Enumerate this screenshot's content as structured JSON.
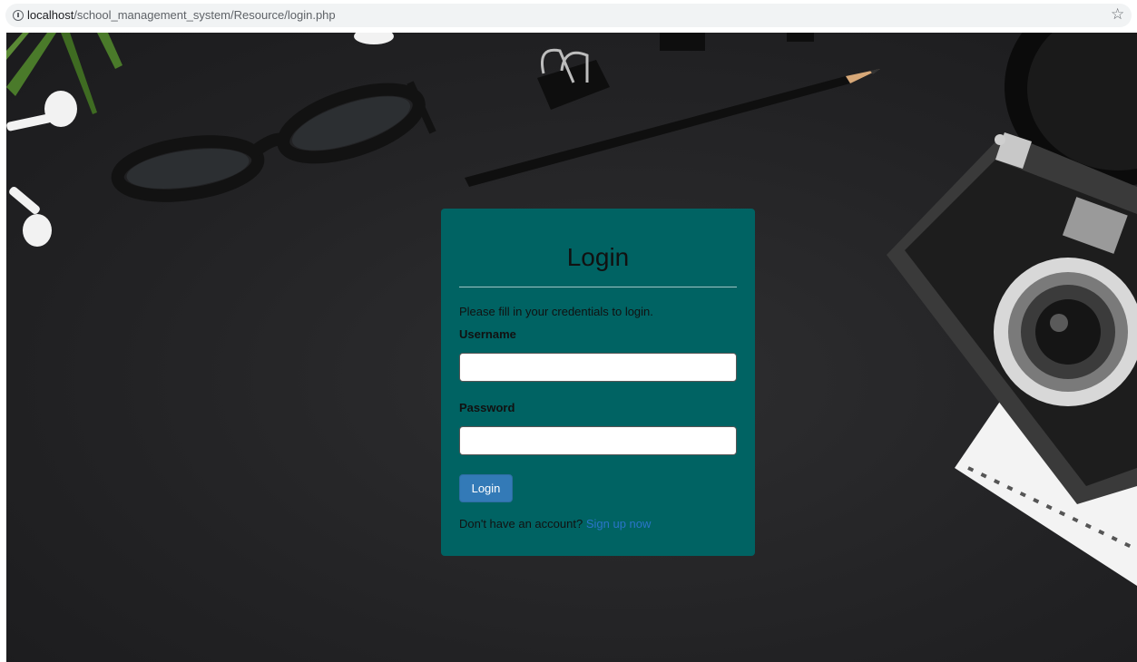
{
  "browser": {
    "url_host": "localhost",
    "url_path": "/school_management_system/Resource/login.php"
  },
  "login": {
    "title": "Login",
    "intro": "Please fill in your credentials to login.",
    "username_label": "Username",
    "username_value": "",
    "password_label": "Password",
    "password_value": "",
    "submit_label": "Login",
    "signup_prompt": "Don't have an account?",
    "signup_link": "Sign up now"
  },
  "colors": {
    "card_background": "#006363",
    "button_primary": "#337ab7",
    "link": "#2a75c9",
    "page_background": "#222224"
  },
  "icons": {
    "address_info": "info-icon",
    "bookmark": "star-icon"
  }
}
